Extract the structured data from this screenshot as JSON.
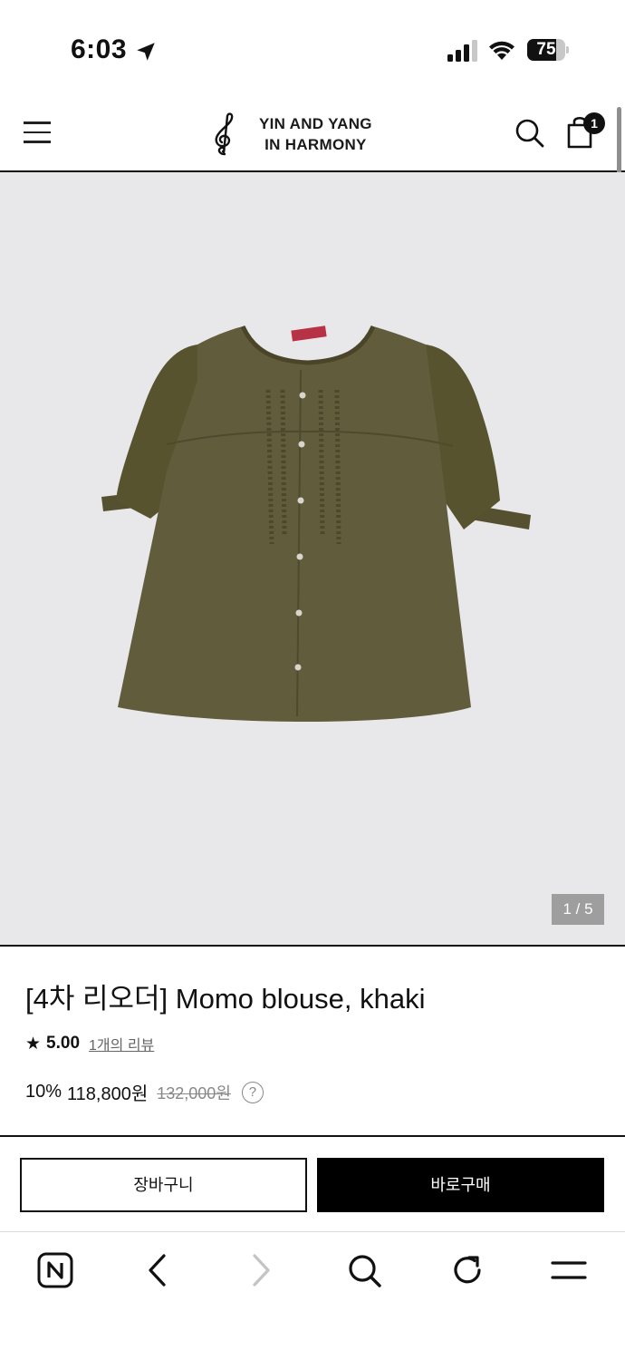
{
  "status_bar": {
    "time": "6:03",
    "battery_level": 75,
    "battery_text": "75"
  },
  "header": {
    "logo_line1": "YIN AND YANG",
    "logo_line2": "IN HARMONY",
    "cart_count": "1"
  },
  "product": {
    "image_counter": "1 / 5",
    "title": "[4차 리오더] Momo blouse, khaki",
    "rating_star": "★",
    "rating": "5.00",
    "review_link": "1개의 리뷰",
    "discount": "10%",
    "sale_price": "118,800원",
    "original_price": "132,000원",
    "help": "?"
  },
  "actions": {
    "add_to_cart": "장바구니",
    "buy_now": "바로구매"
  },
  "browser_bar": {
    "items": [
      "naver-home",
      "back",
      "forward",
      "search",
      "reload",
      "menu"
    ]
  },
  "colors": {
    "image_background": "#e8e8ea",
    "blouse": "#5f5a3c",
    "accent": "#000000"
  }
}
